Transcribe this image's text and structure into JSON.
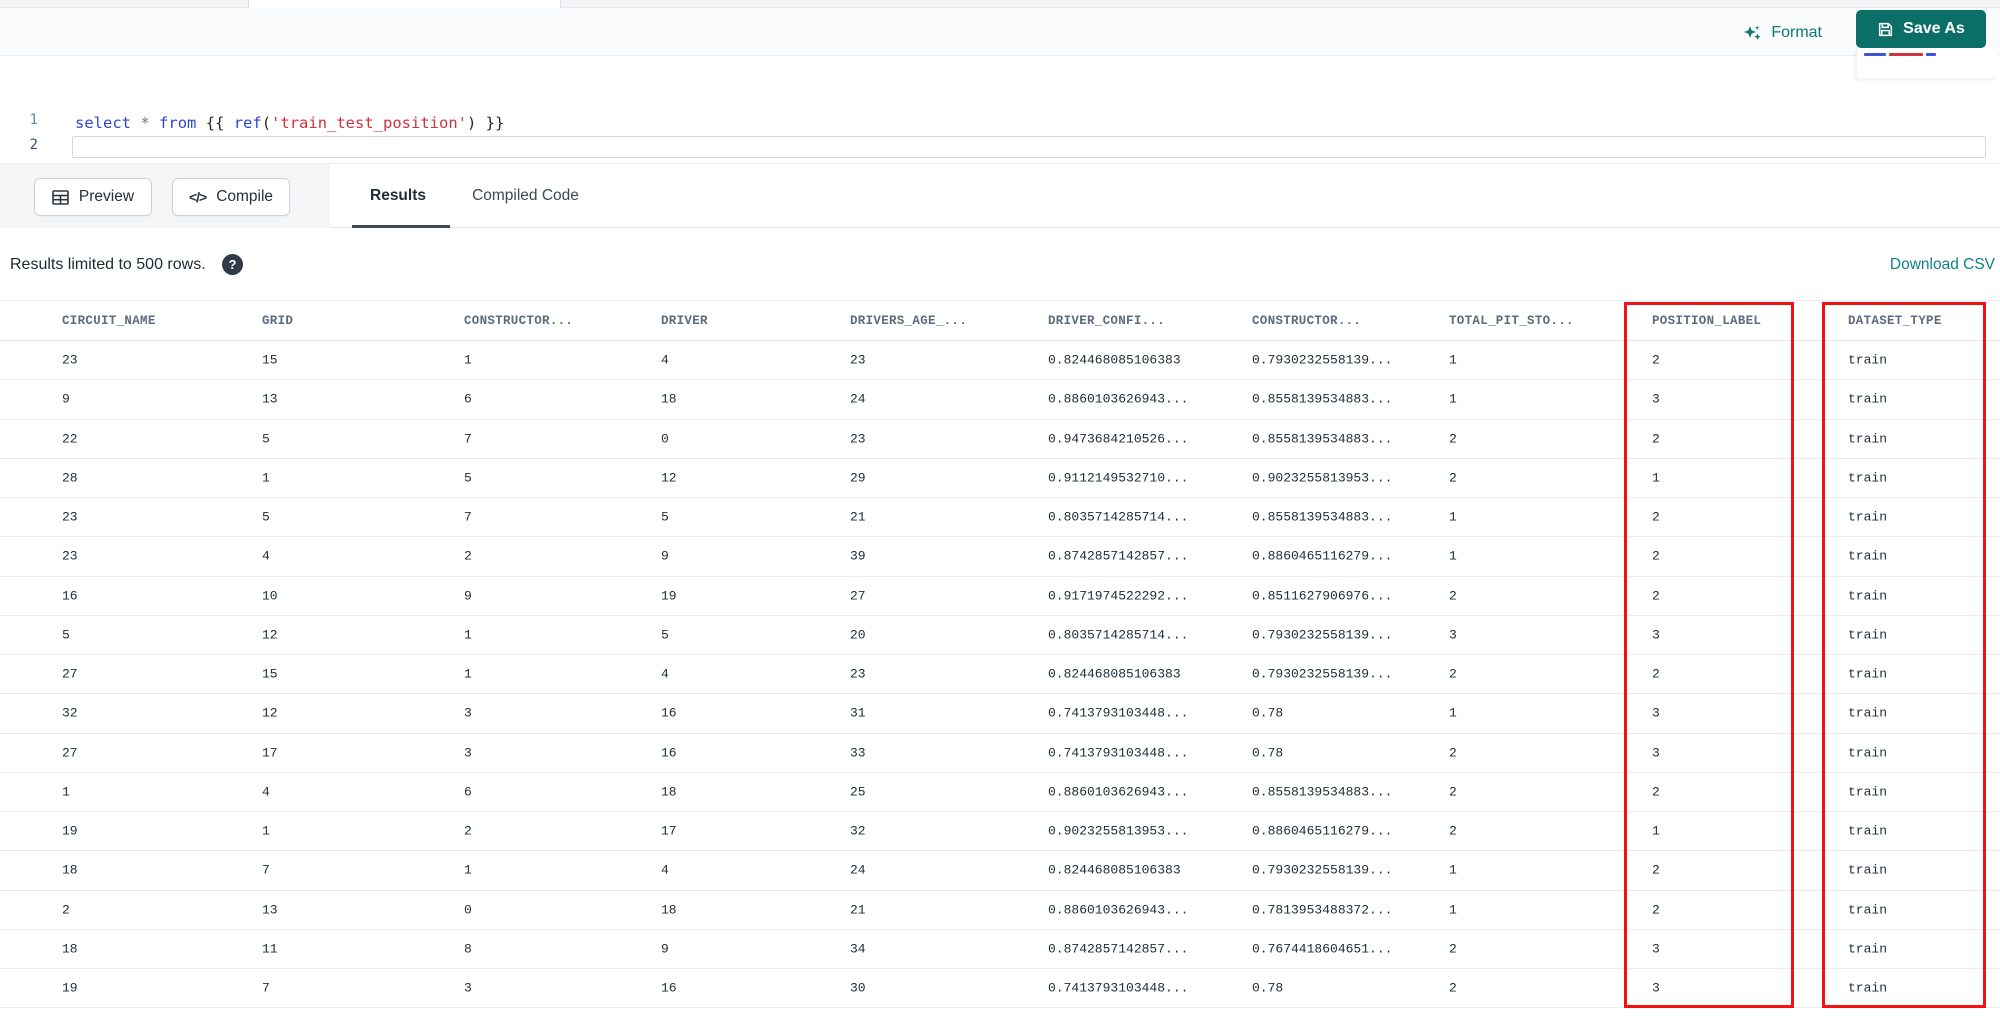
{
  "editor": {
    "format_label": "Format",
    "save_as_label": "Save As",
    "line_numbers": [
      "1",
      "2"
    ],
    "code_text": "select * from {{ ref('train_test_position') }}",
    "code_tokens": [
      {
        "text": "select",
        "type": "keyword"
      },
      {
        "text": " ",
        "type": "plain"
      },
      {
        "text": "*",
        "type": "operator"
      },
      {
        "text": " ",
        "type": "plain"
      },
      {
        "text": "from",
        "type": "keyword"
      },
      {
        "text": " {{ ",
        "type": "brace"
      },
      {
        "text": "ref",
        "type": "function"
      },
      {
        "text": "(",
        "type": "brace"
      },
      {
        "text": "'train_test_position'",
        "type": "string"
      },
      {
        "text": ")",
        "type": "brace"
      },
      {
        "text": " }}",
        "type": "brace"
      }
    ]
  },
  "toolbar": {
    "preview_label": "Preview",
    "compile_label": "Compile",
    "tabs": [
      {
        "label": "Results",
        "active": true
      },
      {
        "label": "Compiled Code",
        "active": false
      }
    ]
  },
  "icons": {
    "compile_glyph": "</>",
    "help_glyph": "?"
  },
  "results_bar": {
    "limit_text": "Results limited to 500 rows.",
    "download_label": "Download CSV"
  },
  "results_table": {
    "columns": [
      "CIRCUIT_NAME",
      "GRID",
      "CONSTRUCTOR...",
      "DRIVER",
      "DRIVERS_AGE_...",
      "DRIVER_CONFI...",
      "CONSTRUCTOR...",
      "TOTAL_PIT_STO...",
      "POSITION_LABEL",
      "DATASET_TYPE"
    ],
    "highlighted_columns": [
      "POSITION_LABEL",
      "DATASET_TYPE"
    ],
    "rows": [
      [
        "23",
        "15",
        "1",
        "4",
        "23",
        "0.824468085106383",
        "0.7930232558139...",
        "1",
        "2",
        "train"
      ],
      [
        "9",
        "13",
        "6",
        "18",
        "24",
        "0.8860103626943...",
        "0.8558139534883...",
        "1",
        "3",
        "train"
      ],
      [
        "22",
        "5",
        "7",
        "0",
        "23",
        "0.9473684210526...",
        "0.8558139534883...",
        "2",
        "2",
        "train"
      ],
      [
        "28",
        "1",
        "5",
        "12",
        "29",
        "0.9112149532710...",
        "0.9023255813953...",
        "2",
        "1",
        "train"
      ],
      [
        "23",
        "5",
        "7",
        "5",
        "21",
        "0.8035714285714...",
        "0.8558139534883...",
        "1",
        "2",
        "train"
      ],
      [
        "23",
        "4",
        "2",
        "9",
        "39",
        "0.8742857142857...",
        "0.8860465116279...",
        "1",
        "2",
        "train"
      ],
      [
        "16",
        "10",
        "9",
        "19",
        "27",
        "0.9171974522292...",
        "0.8511627906976...",
        "2",
        "2",
        "train"
      ],
      [
        "5",
        "12",
        "1",
        "5",
        "20",
        "0.8035714285714...",
        "0.7930232558139...",
        "3",
        "3",
        "train"
      ],
      [
        "27",
        "15",
        "1",
        "4",
        "23",
        "0.824468085106383",
        "0.7930232558139...",
        "2",
        "2",
        "train"
      ],
      [
        "32",
        "12",
        "3",
        "16",
        "31",
        "0.7413793103448...",
        "0.78",
        "1",
        "3",
        "train"
      ],
      [
        "27",
        "17",
        "3",
        "16",
        "33",
        "0.7413793103448...",
        "0.78",
        "2",
        "3",
        "train"
      ],
      [
        "1",
        "4",
        "6",
        "18",
        "25",
        "0.8860103626943...",
        "0.8558139534883...",
        "2",
        "2",
        "train"
      ],
      [
        "19",
        "1",
        "2",
        "17",
        "32",
        "0.9023255813953...",
        "0.8860465116279...",
        "2",
        "1",
        "train"
      ],
      [
        "18",
        "7",
        "1",
        "4",
        "24",
        "0.824468085106383",
        "0.7930232558139...",
        "1",
        "2",
        "train"
      ],
      [
        "2",
        "13",
        "0",
        "18",
        "21",
        "0.8860103626943...",
        "0.7813953488372...",
        "1",
        "2",
        "train"
      ],
      [
        "18",
        "11",
        "8",
        "9",
        "34",
        "0.8742857142857...",
        "0.7674418604651...",
        "2",
        "3",
        "train"
      ],
      [
        "19",
        "7",
        "3",
        "16",
        "30",
        "0.7413793103448...",
        "0.78",
        "2",
        "3",
        "train"
      ]
    ]
  },
  "colors": {
    "accent_teal": "#0b6f68",
    "link_teal": "#10808a",
    "highlight_red": "#f21212"
  }
}
